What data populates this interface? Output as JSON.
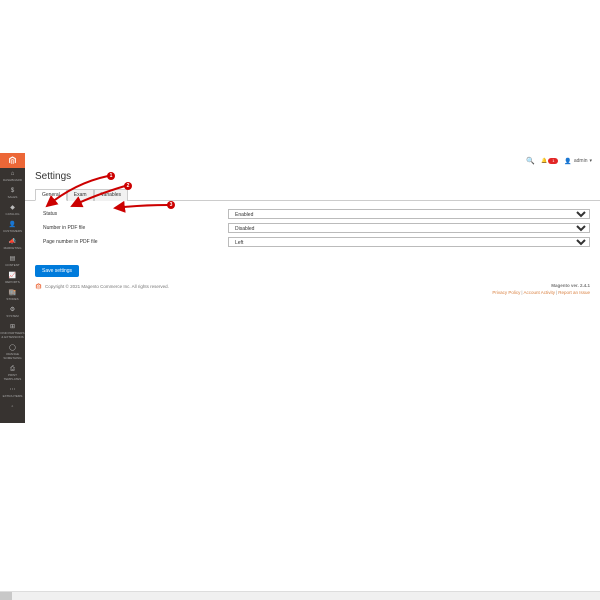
{
  "sidebar": {
    "items": [
      {
        "label": "DASHBOARD",
        "icon": "⌂"
      },
      {
        "label": "SALES",
        "icon": "$"
      },
      {
        "label": "CATALOG",
        "icon": "◆"
      },
      {
        "label": "CUSTOMERS",
        "icon": "👤"
      },
      {
        "label": "MARKETING",
        "icon": "📣"
      },
      {
        "label": "CONTENT",
        "icon": "▤"
      },
      {
        "label": "REPORTS",
        "icon": "📈"
      },
      {
        "label": "STORES",
        "icon": "🏬"
      },
      {
        "label": "SYSTEM",
        "icon": "⚙"
      },
      {
        "label": "FIND PARTNERS & EXTENSIONS",
        "icon": "⊞"
      },
      {
        "label": "ORANGE SOMETHING",
        "icon": "◯"
      },
      {
        "label": "PRINT TEMPLATES",
        "icon": "⎙"
      },
      {
        "label": "EXTRA ITEMS",
        "icon": "⋯"
      },
      {
        "label": "",
        "icon": "◦"
      }
    ]
  },
  "topbar": {
    "notif_count": "1",
    "user": "admin",
    "caret": "▾"
  },
  "page": {
    "title": "Settings"
  },
  "tabs": [
    {
      "label": "General",
      "active": true
    },
    {
      "label": "Exam",
      "active": false
    },
    {
      "label": "Variables",
      "active": false
    }
  ],
  "form": {
    "rows": [
      {
        "label": "Status",
        "value": "Enabled"
      },
      {
        "label": "Number in PDF file",
        "value": "Disabled"
      },
      {
        "label": "Page number in PDF file",
        "value": "Left"
      }
    ],
    "save": "Save settings"
  },
  "footer": {
    "copyright": "Copyright © 2021 Magento Commerce Inc. All rights reserved.",
    "version_label": "Magento ver. 2.4.1",
    "links": {
      "privacy": "Privacy Policy",
      "account": "Account Activity",
      "report": "Report an Issue"
    }
  },
  "annotations": {
    "n1": "1",
    "n2": "2",
    "n3": "3"
  }
}
